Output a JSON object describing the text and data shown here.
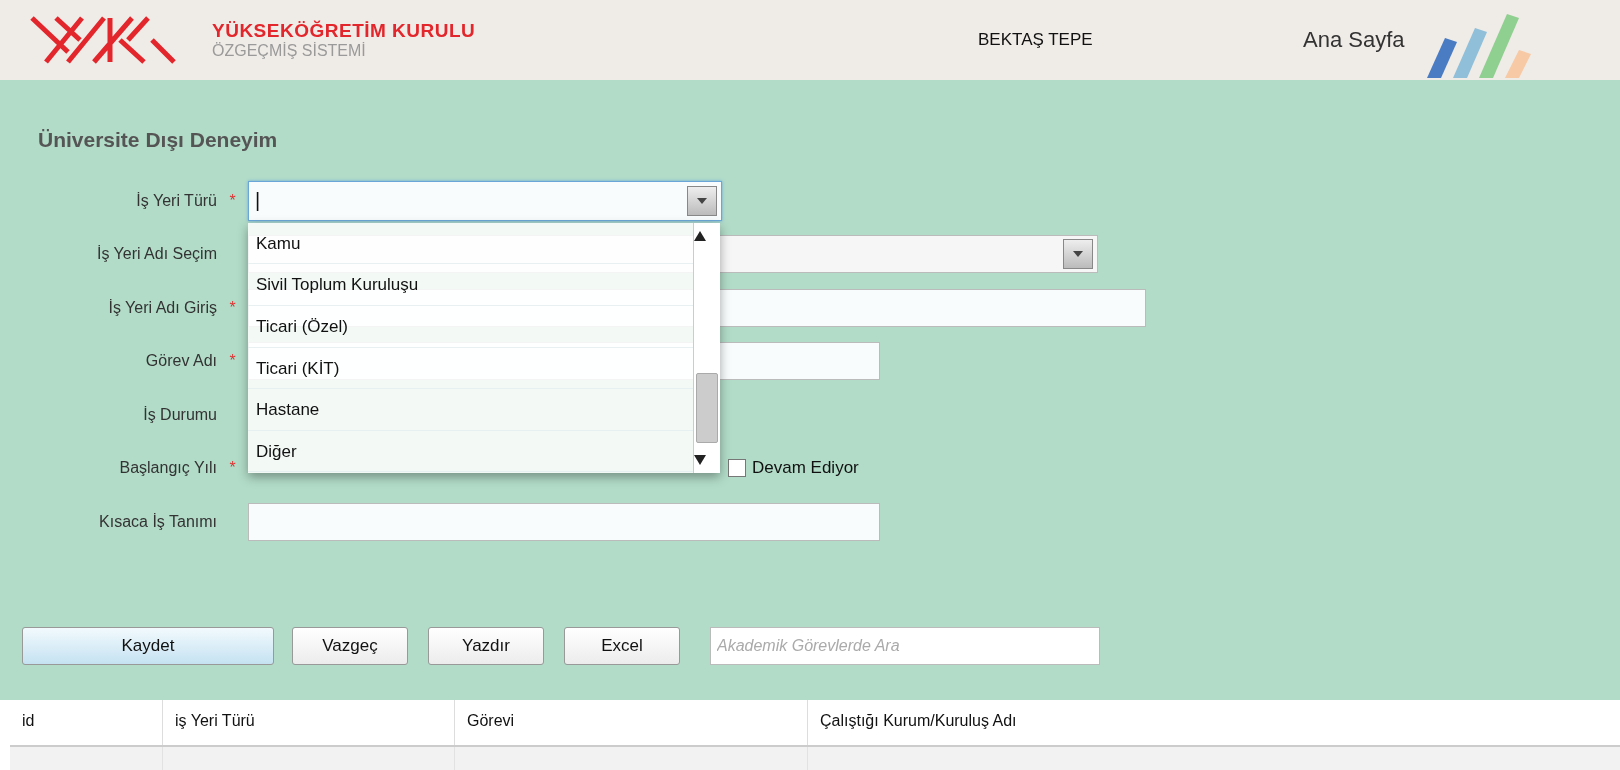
{
  "header": {
    "org_name": "YÜKSEKÖĞRETİM KURULU",
    "system_name": "ÖZGEÇMİŞ SİSTEMİ",
    "user_name": "BEKTAŞ TEPE",
    "home_link": "Ana Sayfa"
  },
  "page_title": "Üniversite Dışı Deneyim",
  "fields": [
    {
      "kind": "combo",
      "label": "İş Yeri Türü",
      "required_mark": "*",
      "value": "|",
      "expanded": true,
      "options": [
        {
          "label": "Kamu",
          "selected": false
        },
        {
          "label": "Sivil Toplum Kuruluşu",
          "selected": false
        },
        {
          "label": "Ticari (Özel)",
          "selected": false
        },
        {
          "label": "Ticari (KİT)",
          "selected": false
        },
        {
          "label": "Hastane",
          "selected": false
        },
        {
          "label": "Diğer",
          "selected": false
        }
      ]
    },
    {
      "kind": "select",
      "label": "İş Yeri Adı Seçim"
    },
    {
      "kind": "text",
      "label": "İş Yeri Adı Giriş",
      "required_mark": "*"
    },
    {
      "kind": "text",
      "label": "Görev Adı",
      "required_mark": "*"
    },
    {
      "kind": "radio",
      "label": "İş Durumu"
    },
    {
      "kind": "years",
      "label": "Başlangıç Yılı",
      "required_mark": "*",
      "ongoing_label": "Devam Ediyor",
      "ongoing_checked": false
    },
    {
      "kind": "text",
      "label": "Kısaca İş Tanımı"
    }
  ],
  "buttons": [
    {
      "label": "Kaydet",
      "kind": "primary"
    },
    {
      "label": "Vazgeç",
      "kind": "plain"
    },
    {
      "label": "Yazdır",
      "kind": "plain"
    },
    {
      "label": "Excel",
      "kind": "plain"
    }
  ],
  "search": {
    "placeholder": "Akademik Görevlerde Ara"
  },
  "table": {
    "columns": [
      "id",
      "iş Yeri Türü",
      "Görevi",
      "Çalıştığı Kurum/Kuruluş Adı"
    ]
  }
}
